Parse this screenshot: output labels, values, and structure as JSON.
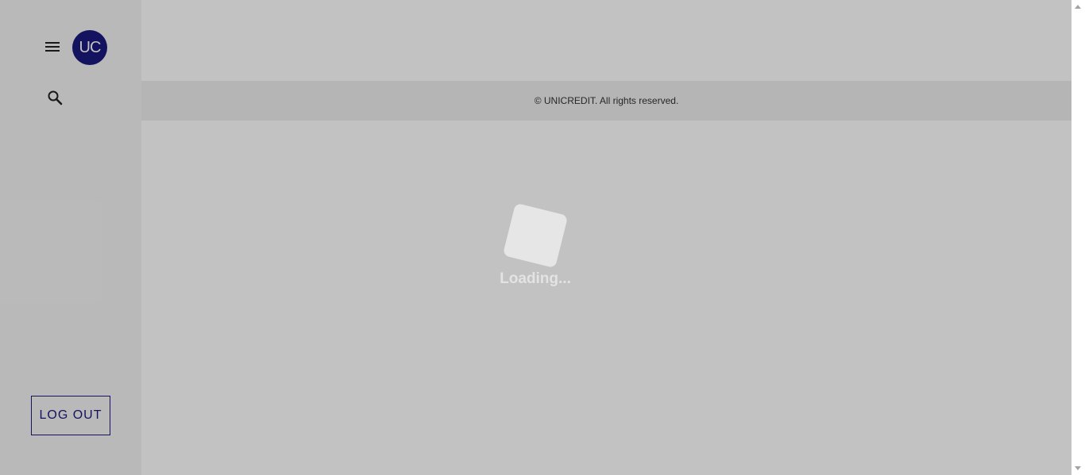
{
  "sidebar": {
    "avatar_initials": "UC",
    "menu_icon": "hamburger-menu-icon",
    "search_icon": "search-icon",
    "logout_label": "LOG OUT"
  },
  "footer": {
    "copyright": "© UNICREDIT. All rights reserved."
  },
  "loader": {
    "text": "Loading..."
  },
  "colors": {
    "brand": "#1a1a7e",
    "overlay": "rgba(0,0,0,0.24)"
  }
}
